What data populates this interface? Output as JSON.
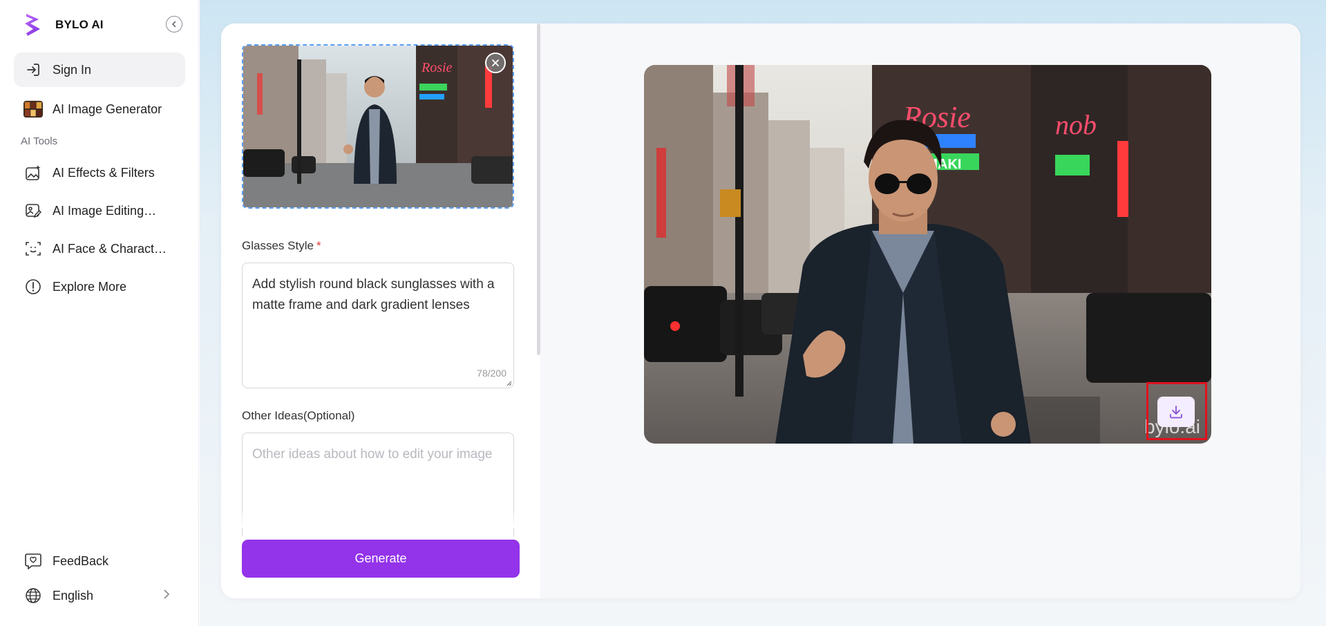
{
  "brand": {
    "name": "BYLO AI"
  },
  "sidebar": {
    "sign_in": "Sign In",
    "image_generator": "AI Image Generator",
    "section_label": "AI Tools",
    "items": [
      {
        "label": "AI Effects & Filters",
        "icon": "image-sparkle-icon"
      },
      {
        "label": "AI Image Editing…",
        "icon": "image-edit-icon"
      },
      {
        "label": "AI Face & Charact…",
        "icon": "face-scan-icon"
      },
      {
        "label": "Explore More",
        "icon": "more-circle-icon"
      }
    ],
    "feedback": "FeedBack",
    "language": "English"
  },
  "form": {
    "glasses_label": "Glasses Style",
    "required_mark": "*",
    "glasses_value": "Add stylish round black sunglasses with a matte frame and dark gradient lenses",
    "glasses_counter": "78/200",
    "other_label": "Other Ideas(Optional)",
    "other_placeholder": "Other ideas about how to edit your image",
    "generate_label": "Generate"
  },
  "result": {
    "watermark": "bylo.ai"
  },
  "colors": {
    "accent": "#9333ea",
    "highlight": "#e0121f",
    "upload_border": "#5b9df5"
  }
}
